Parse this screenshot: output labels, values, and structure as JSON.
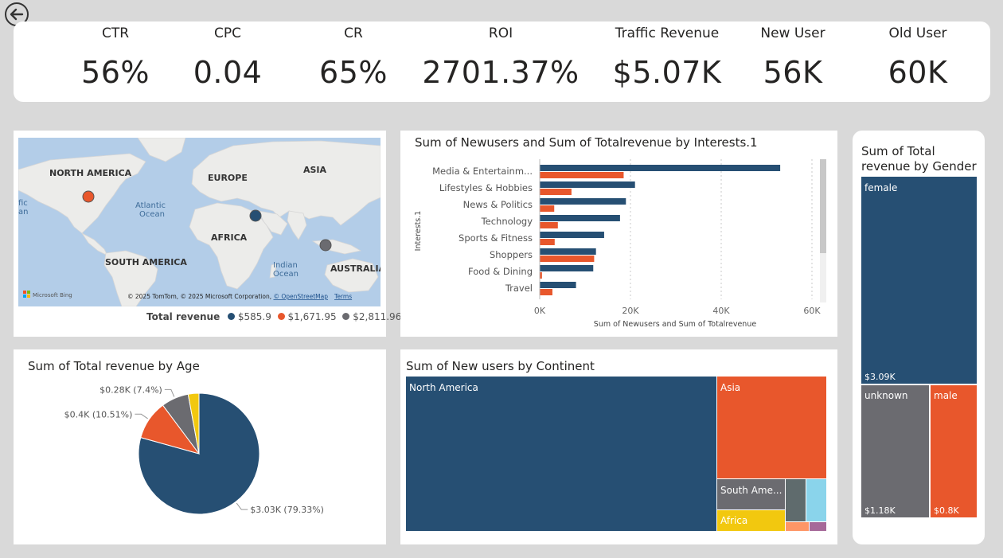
{
  "kpis": [
    {
      "label": "CTR",
      "value": "56%"
    },
    {
      "label": "CPC",
      "value": "0.04"
    },
    {
      "label": "CR",
      "value": "65%"
    },
    {
      "label": "ROI",
      "value": "2701.37%"
    },
    {
      "label": "Traffic Revenue",
      "value": "$5.07K"
    },
    {
      "label": "New User",
      "value": "56K"
    },
    {
      "label": "Old User",
      "value": "60K"
    }
  ],
  "map": {
    "labels": {
      "north_america": "NORTH AMERICA",
      "europe": "EUROPE",
      "asia": "ASIA",
      "atlantic": "Atlantic",
      "ocean1": "Ocean",
      "africa": "AFRICA",
      "south_america": "SOUTH AMERICA",
      "indian": "Indian",
      "ocean2": "Ocean",
      "australia": "AUSTRALIA",
      "pacific_edge": "fic",
      "pacific_edge2": "an"
    },
    "bing": "Microsoft Bing",
    "copyright": "© 2025 TomTom, © 2025 Microsoft Corporation, ",
    "osm": "© OpenStreetMap",
    "terms": "Terms",
    "legend_title": "Total revenue",
    "legend": [
      {
        "label": "$585.9",
        "color": "#264f73"
      },
      {
        "label": "$1,671.95",
        "color": "#e8572c"
      },
      {
        "label": "$2,811.96",
        "color": "#6b6b70"
      }
    ],
    "colors": {
      "land": "#ececea",
      "water": "#b3cde8"
    }
  },
  "bar_chart": {
    "title": "Sum of Newusers and Sum of Totalrevenue by Interests.1",
    "y_axis_title": "Interests.1",
    "x_axis_title": "Sum of Newusers and Sum of Totalrevenue",
    "x_ticks": [
      "0K",
      "20K",
      "40K",
      "60K"
    ]
  },
  "pie": {
    "title": "Sum of Total revenue by Age",
    "labels": [
      "$3.03K (79.33%)",
      "$0.4K (10.51%)",
      "$0.28K (7.4%)"
    ]
  },
  "treemap_continent": {
    "title": "Sum of New users by Continent",
    "labels": {
      "north_america": "North America",
      "asia": "Asia",
      "south_america": "South Ame...",
      "africa": "Africa"
    }
  },
  "treemap_gender": {
    "title_line1": "Sum of Total",
    "title_line2": "revenue by Gender",
    "labels": {
      "female": "female",
      "female_val": "$3.09K",
      "unknown": "unknown",
      "unknown_val": "$1.18K",
      "male": "male",
      "male_val": "$0.8K"
    }
  },
  "chart_data": [
    {
      "type": "bar",
      "title": "Sum of Newusers and Sum of Totalrevenue by Interests.1",
      "ylabel": "Interests.1",
      "xlabel": "Sum of Newusers and Sum of Totalrevenue",
      "categories": [
        "Media & Entertainm...",
        "Lifestyles & Hobbies",
        "News & Politics",
        "Technology",
        "Sports & Fitness",
        "Shoppers",
        "Food & Dining",
        "Travel"
      ],
      "series": [
        {
          "values": [
            53000,
            21000,
            19000,
            17700,
            14200,
            12400,
            11800,
            8000
          ],
          "color": "#264f73"
        },
        {
          "values": [
            18500,
            7000,
            3200,
            4000,
            3300,
            12000,
            500,
            2800
          ],
          "color": "#e8572c"
        }
      ],
      "xlim": [
        0,
        60000
      ],
      "grid": true
    },
    {
      "type": "pie",
      "title": "Sum of Total revenue by Age",
      "values": [
        3030,
        400,
        280,
        110
      ],
      "labels": [
        "$3.03K (79.33%)",
        "$0.4K (10.51%)",
        "$0.28K (7.4%)",
        ""
      ],
      "colors": [
        "#264f73",
        "#e8572c",
        "#6b6b70",
        "#f2c80f"
      ]
    },
    {
      "type": "treemap",
      "title": "Sum of New users by Continent",
      "categories": [
        "North America",
        "Asia",
        "South Ame...",
        "Africa"
      ],
      "colors": [
        "#264f73",
        "#e8572c",
        "#6b6b70",
        "#f2c80f",
        "#5f6b6d",
        "#8ad4eb",
        "#fe9666",
        "#a66999"
      ]
    },
    {
      "type": "treemap",
      "title": "Sum of Total revenue by Gender",
      "categories": [
        "female",
        "unknown",
        "male"
      ],
      "values": [
        3090,
        1180,
        800
      ],
      "colors": [
        "#264f73",
        "#6b6b70",
        "#e8572c"
      ]
    }
  ]
}
